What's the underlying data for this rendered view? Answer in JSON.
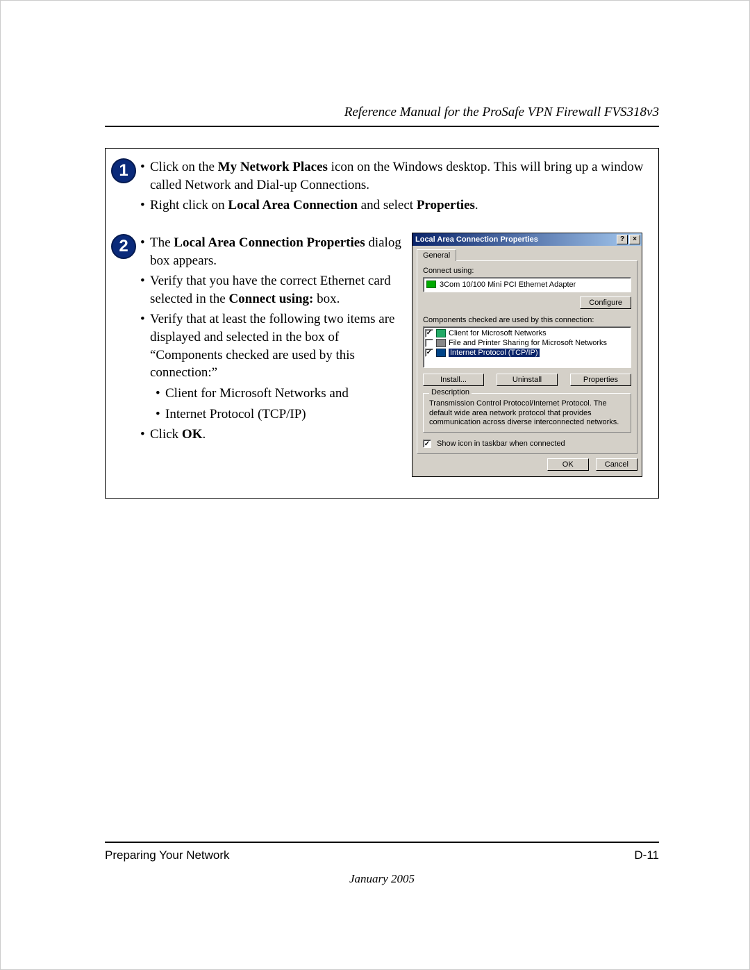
{
  "header": {
    "title": "Reference Manual for the ProSafe VPN Firewall FVS318v3"
  },
  "step1": {
    "badge": "1",
    "b1_pre": "Click on the ",
    "b1_bold": "My Network Places",
    "b1_post": " icon on the Windows desktop.  This will bring up a window called Network and Dial-up Connections.",
    "b2_pre": "Right click on ",
    "b2_bold1": "Local Area Connection",
    "b2_mid": " and select ",
    "b2_bold2": "Properties",
    "b2_post": "."
  },
  "step2": {
    "badge": "2",
    "b1_pre": "The ",
    "b1_bold": "Local Area Connection Properties",
    "b1_post": " dialog box appears.",
    "b2_pre": "Verify that you have the correct Ethernet card selected in the ",
    "b2_bold": "Connect using:",
    "b2_post": " box.",
    "b3": "Verify that at least the following two items are displayed and selected in the box of “Components checked are used by this connection:”",
    "s1": "Client for Microsoft Networks and",
    "s2": "Internet Protocol (TCP/IP)",
    "b4_pre": "Click ",
    "b4_bold": "OK",
    "b4_post": "."
  },
  "dialog": {
    "title": "Local Area Connection Properties",
    "help": "?",
    "close": "×",
    "tab": "General",
    "connect_label": "Connect using:",
    "nic": "3Com 10/100 Mini PCI Ethernet Adapter",
    "configure": "Configure",
    "comp_label": "Components checked are used by this connection:",
    "c1": "Client for Microsoft Networks",
    "c2": "File and Printer Sharing for Microsoft Networks",
    "c3": "Internet Protocol (TCP/IP)",
    "c1_chk": "✓",
    "c2_chk": "",
    "c3_chk": "✓",
    "install": "Install...",
    "uninstall": "Uninstall",
    "properties": "Properties",
    "desc_title": "Description",
    "desc_text": "Transmission Control Protocol/Internet Protocol. The default wide area network protocol that provides communication across diverse interconnected networks.",
    "taskbar_chk": "✓",
    "taskbar": "Show icon in taskbar when connected",
    "ok": "OK",
    "cancel": "Cancel"
  },
  "footer": {
    "section": "Preparing Your Network",
    "page": "D-11",
    "date": "January 2005"
  }
}
